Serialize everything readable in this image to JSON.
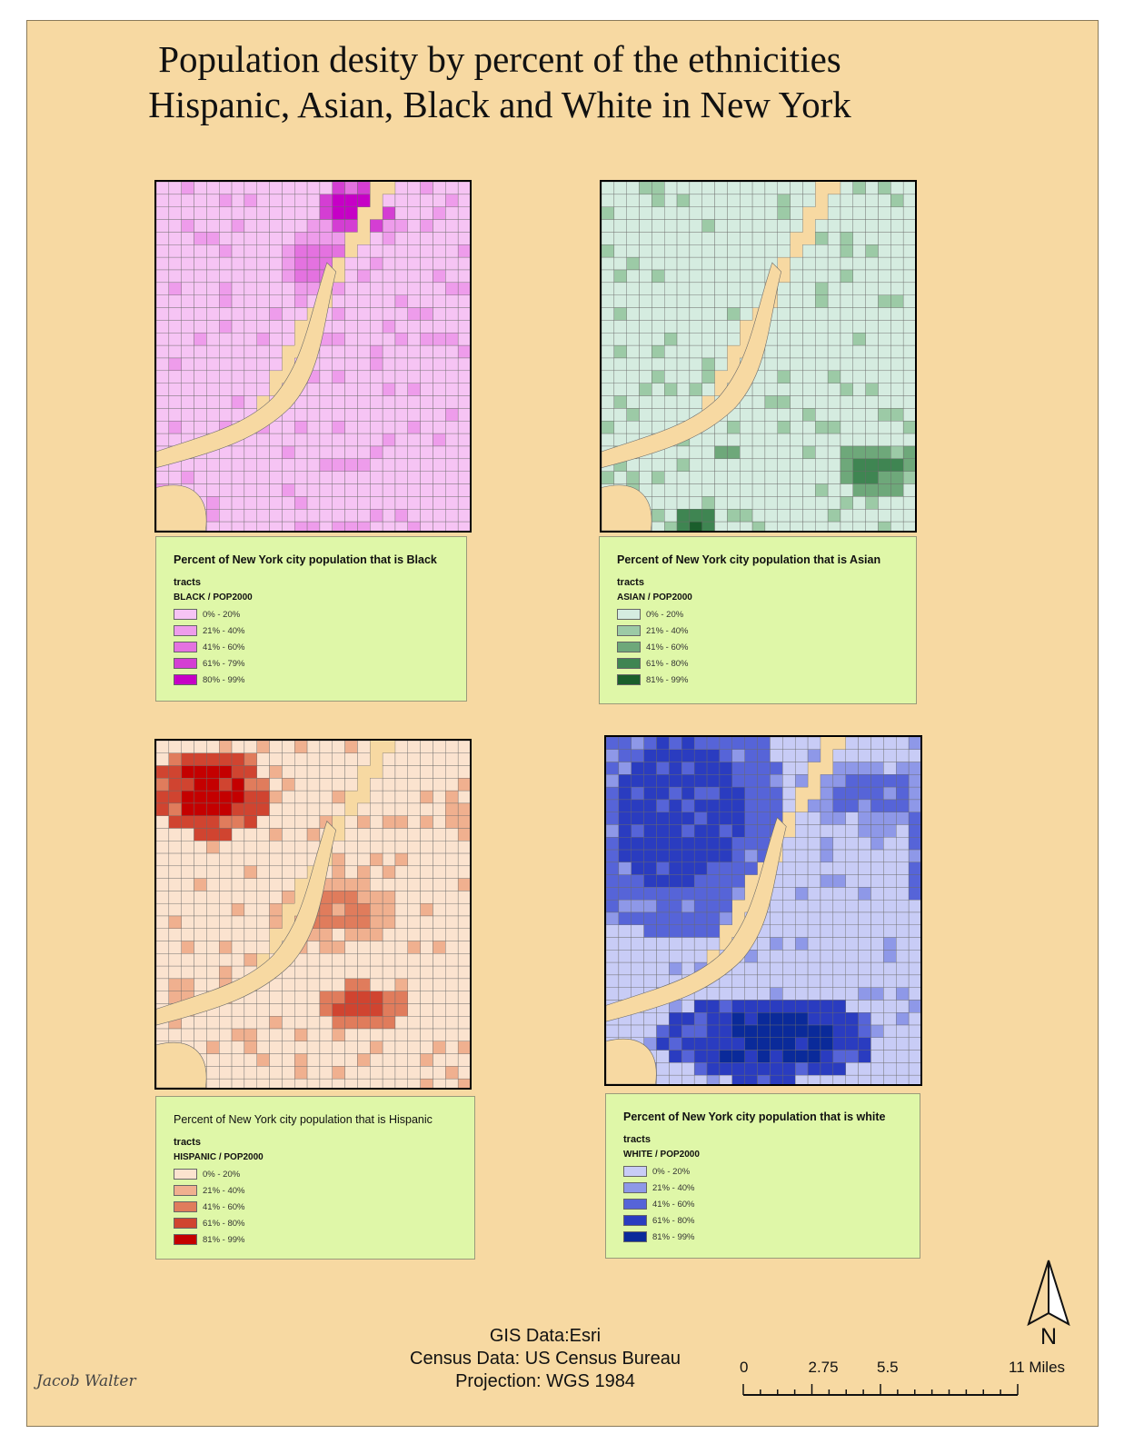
{
  "title": {
    "line1": "Population desity by percent of the ethnicities",
    "line2": "Hispanic, Asian, Black and White in New York"
  },
  "maps": [
    {
      "key": "black",
      "land_color": "#f0b8f0",
      "water_color": "#f7d9a2",
      "legend": {
        "title": "Percent of New York city population that is Black",
        "subtitle": "tracts",
        "field": "BLACK / POP2000",
        "classes": [
          {
            "label": "0% - 20%",
            "color": "#f6c4f4"
          },
          {
            "label": "21% - 40%",
            "color": "#ee9ceb"
          },
          {
            "label": "41% - 60%",
            "color": "#e472e0"
          },
          {
            "label": "61% - 79%",
            "color": "#d43ed3"
          },
          {
            "label": "80% - 99%",
            "color": "#c600c6"
          }
        ]
      }
    },
    {
      "key": "asian",
      "land_color": "#d8eee2",
      "water_color": "#f7d9a2",
      "legend": {
        "title": "Percent of New York city population that is Asian",
        "subtitle": "tracts",
        "field": "ASIAN / POP2000",
        "classes": [
          {
            "label": "0% - 20%",
            "color": "#d5ece0"
          },
          {
            "label": "21% - 40%",
            "color": "#9ccaa6"
          },
          {
            "label": "41% - 60%",
            "color": "#6ea87a"
          },
          {
            "label": "61% - 80%",
            "color": "#3f8552"
          },
          {
            "label": "81% - 99%",
            "color": "#1a5e2c"
          }
        ]
      }
    },
    {
      "key": "hispanic",
      "land_color": "#fbe3cf",
      "water_color": "#f7d9a2",
      "legend": {
        "title": "Percent of New York city population that is Hispanic",
        "subtitle": "tracts",
        "field": "HISPANIC / POP2000",
        "classes": [
          {
            "label": "0% - 20%",
            "color": "#fbe3cf"
          },
          {
            "label": "21% - 40%",
            "color": "#f0b08f"
          },
          {
            "label": "41% - 60%",
            "color": "#e07c5c"
          },
          {
            "label": "61% - 80%",
            "color": "#d04430"
          },
          {
            "label": "81% - 99%",
            "color": "#c40000"
          }
        ]
      }
    },
    {
      "key": "white",
      "land_color": "#c8ccf6",
      "water_color": "#f7d9a2",
      "legend": {
        "title": "Percent of  New York city population that is white",
        "subtitle": "tracts",
        "field": "WHITE / POP2000",
        "classes": [
          {
            "label": "0% - 20%",
            "color": "#c8ccf6"
          },
          {
            "label": "21% - 40%",
            "color": "#8e98e8"
          },
          {
            "label": "41% - 60%",
            "color": "#5664d8"
          },
          {
            "label": "61% - 80%",
            "color": "#2a3cc0"
          },
          {
            "label": "81% - 99%",
            "color": "#0a2a9a"
          }
        ]
      }
    }
  ],
  "credits": {
    "line1": "GIS Data:Esri",
    "line2": "Census Data: US Census Bureau",
    "line3": "Projection: WGS 1984"
  },
  "scale_bar": {
    "labels": [
      "0",
      "2.75",
      "5.5",
      "11 Miles"
    ],
    "values": [
      0,
      2.75,
      5.5,
      11
    ],
    "max": 11
  },
  "north_arrow": {
    "label": "N"
  },
  "signature": "Jacob Walter"
}
